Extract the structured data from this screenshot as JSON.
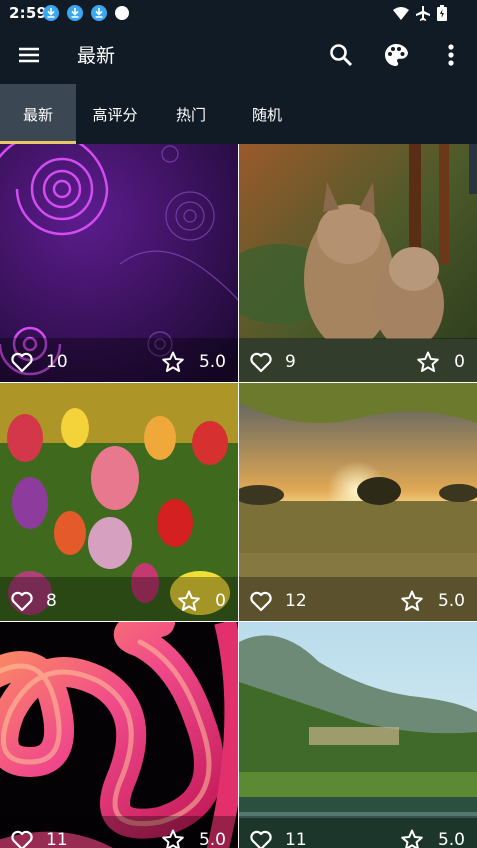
{
  "status_bar": {
    "time": "2:59",
    "left_icons": [
      "download-icon",
      "download-icon",
      "download-icon",
      "dot-icon"
    ],
    "right_icons": [
      "wifi-icon",
      "airplane-icon",
      "battery-icon"
    ]
  },
  "app_bar": {
    "title": "最新",
    "actions": [
      "search-icon",
      "palette-icon",
      "more-vert-icon"
    ]
  },
  "tabs": [
    {
      "label": "最新",
      "active": true
    },
    {
      "label": "高评分",
      "active": false
    },
    {
      "label": "热门",
      "active": false
    },
    {
      "label": "随机",
      "active": false
    }
  ],
  "colors": {
    "background": "#111b26",
    "active_tab": "#3c4754",
    "tab_indicator": "#e8c66a"
  },
  "wallpapers": [
    {
      "subject": "purple-spirals",
      "likes": "10",
      "rating": "5.0"
    },
    {
      "subject": "lynx-cubs",
      "likes": "9",
      "rating": "0"
    },
    {
      "subject": "tulips",
      "likes": "8",
      "rating": "0"
    },
    {
      "subject": "sunset-meadow",
      "likes": "12",
      "rating": "5.0"
    },
    {
      "subject": "pink-tube",
      "likes": "11",
      "rating": "5.0"
    },
    {
      "subject": "river-valley",
      "likes": "11",
      "rating": "5.0"
    }
  ]
}
